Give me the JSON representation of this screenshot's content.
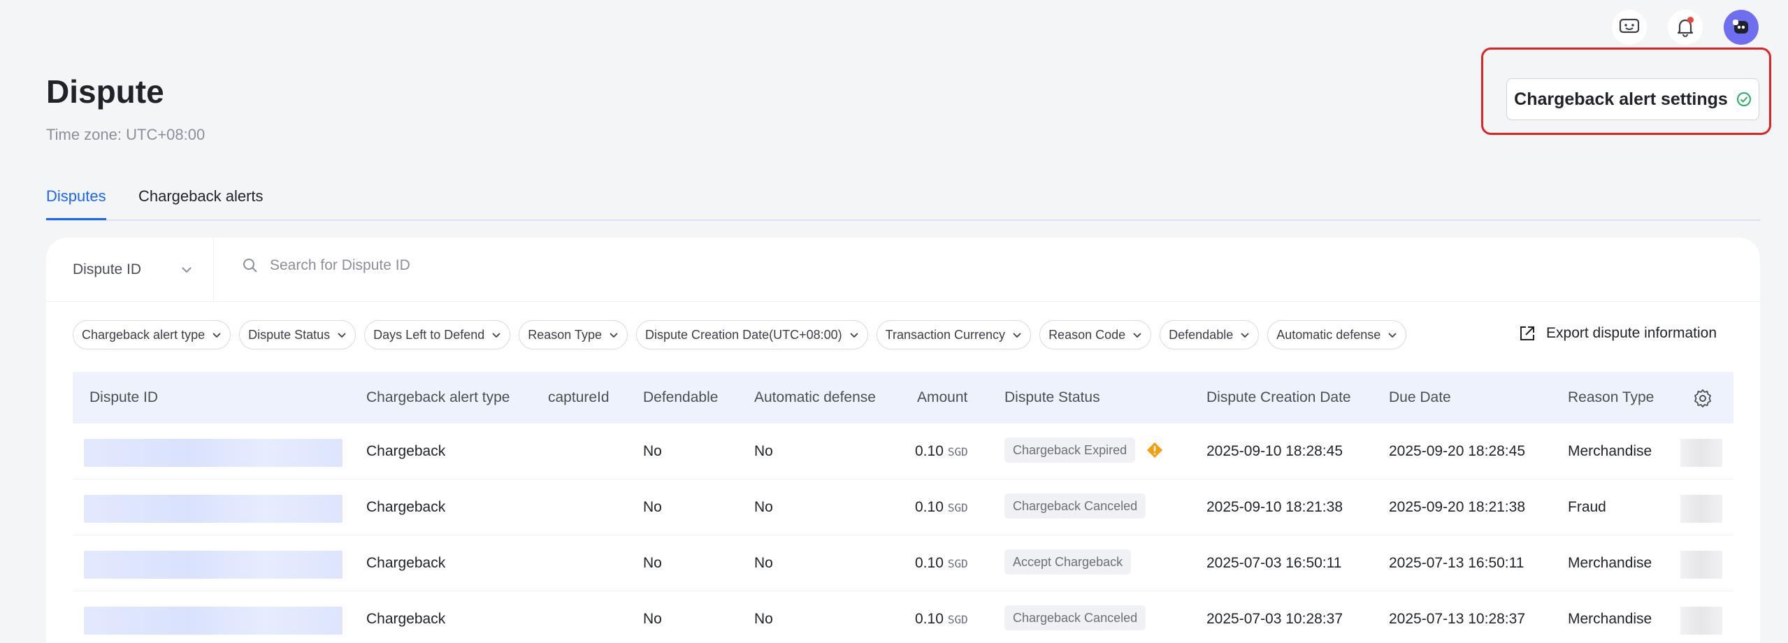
{
  "header": {
    "title": "Dispute",
    "timezone": "Time zone: UTC+08:00",
    "alert_settings_label": "Chargeback alert settings"
  },
  "tabs": [
    {
      "label": "Disputes",
      "active": true
    },
    {
      "label": "Chargeback alerts",
      "active": false
    }
  ],
  "search": {
    "field_select": "Dispute ID",
    "placeholder": "Search for Dispute ID"
  },
  "filters": [
    "Chargeback alert type",
    "Dispute Status",
    "Days Left to Defend",
    "Reason Type",
    "Dispute Creation Date(UTC+08:00)",
    "Transaction Currency",
    "Reason Code",
    "Defendable",
    "Automatic defense"
  ],
  "export_label": "Export dispute information",
  "table": {
    "columns": [
      "Dispute ID",
      "Chargeback alert type",
      "captureId",
      "Defendable",
      "Automatic defense",
      "Amount",
      "Dispute Status",
      "Dispute Creation Date",
      "Due Date",
      "Reason Type"
    ],
    "rows": [
      {
        "alert_type": "Chargeback",
        "defendable": "No",
        "auto_defense": "No",
        "amount": "0.10",
        "currency": "SGD",
        "status": "Chargeback Expired",
        "created": "2025-09-10 18:28:45",
        "due": "2025-09-20 18:28:45",
        "reason": "Merchandise"
      },
      {
        "alert_type": "Chargeback",
        "defendable": "No",
        "auto_defense": "No",
        "amount": "0.10",
        "currency": "SGD",
        "status": "Chargeback Canceled",
        "created": "2025-09-10 18:21:38",
        "due": "2025-09-20 18:21:38",
        "reason": "Fraud"
      },
      {
        "alert_type": "Chargeback",
        "defendable": "No",
        "auto_defense": "No",
        "amount": "0.10",
        "currency": "SGD",
        "status": "Accept Chargeback",
        "created": "2025-07-03 16:50:11",
        "due": "2025-07-13 16:50:11",
        "reason": "Merchandise"
      },
      {
        "alert_type": "Chargeback",
        "defendable": "No",
        "auto_defense": "No",
        "amount": "0.10",
        "currency": "SGD",
        "status": "Chargeback Canceled",
        "created": "2025-07-03 10:28:37",
        "due": "2025-07-13 10:28:37",
        "reason": "Merchandise"
      }
    ]
  },
  "colors": {
    "accent": "#1b66ff",
    "highlight": "#e02424",
    "success": "#27ae60",
    "warning": "#f59e0b"
  }
}
